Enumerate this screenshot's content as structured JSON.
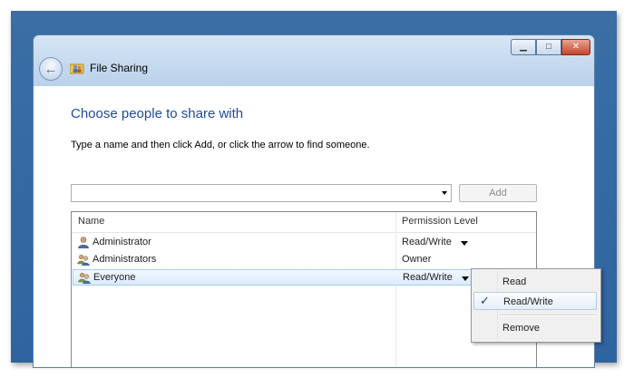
{
  "window": {
    "title": "File Sharing",
    "controls": {
      "minimize": "▁",
      "maximize": "□",
      "close": "✕"
    }
  },
  "main": {
    "heading": "Choose people to share with",
    "instruction": "Type a name and then click Add, or click the arrow to find someone.",
    "name_input": {
      "value": "",
      "placeholder": ""
    },
    "add_button": "Add"
  },
  "table": {
    "columns": [
      "Name",
      "Permission Level"
    ],
    "rows": [
      {
        "name": "Administrator",
        "permission": "Read/Write",
        "has_dropdown": true,
        "icon": "user-icon"
      },
      {
        "name": "Administrators",
        "permission": "Owner",
        "has_dropdown": false,
        "icon": "group-icon"
      },
      {
        "name": "Everyone",
        "permission": "Read/Write",
        "has_dropdown": true,
        "icon": "group-icon",
        "selected": true
      }
    ]
  },
  "permission_menu": {
    "items": [
      {
        "label": "Read",
        "checked": false
      },
      {
        "label": "Read/Write",
        "checked": true
      },
      {
        "label": "Remove",
        "checked": false
      }
    ],
    "check_glyph": "✓"
  },
  "colors": {
    "heading": "#1e4a9b",
    "desktop": "#3a6ea5",
    "selected_row": "#dcebfc"
  }
}
